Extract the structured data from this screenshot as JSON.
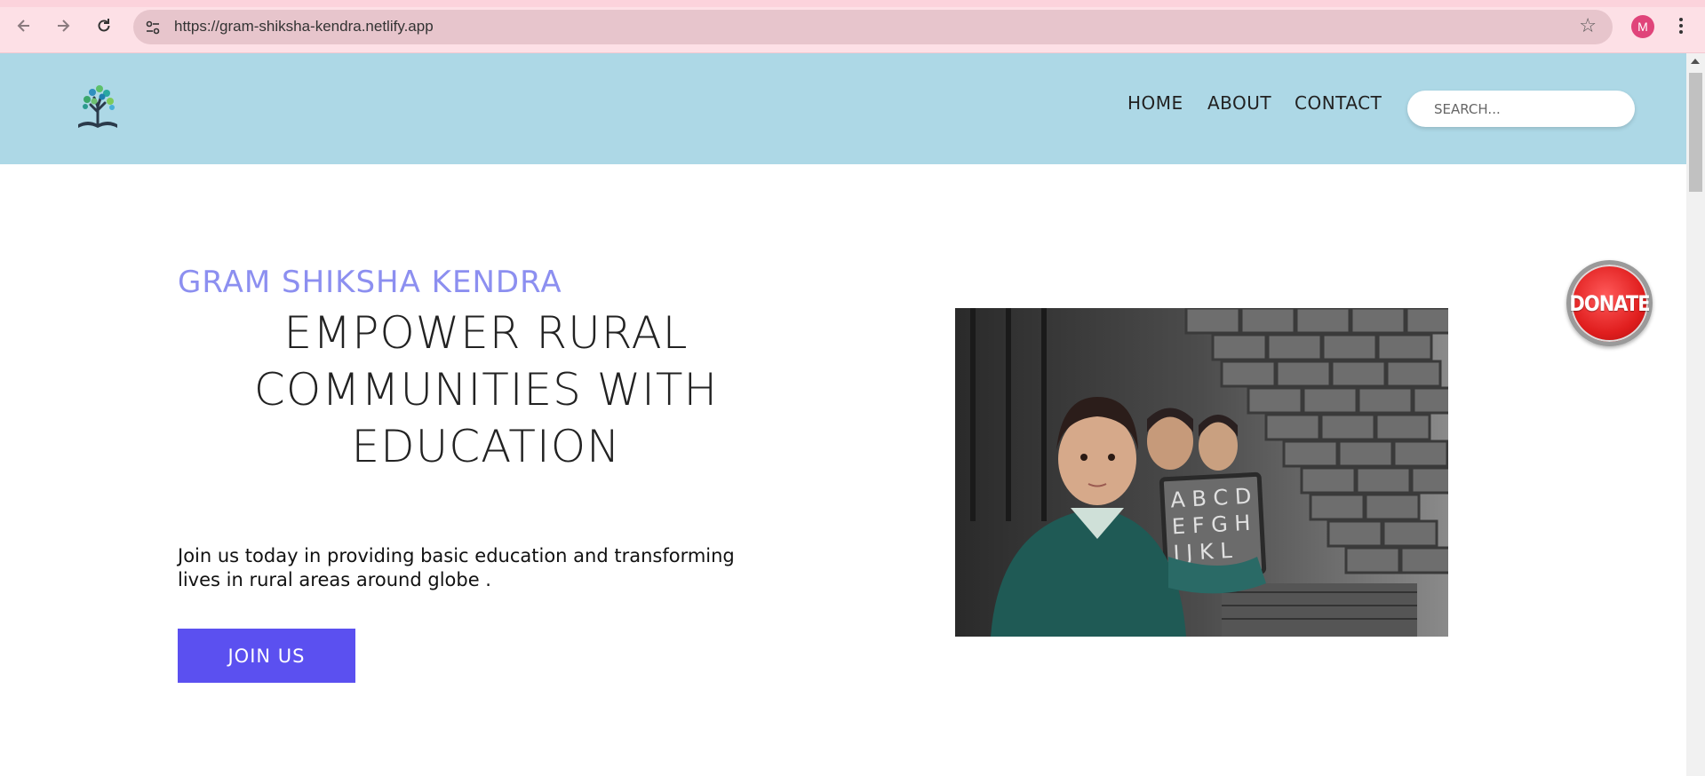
{
  "browser": {
    "url": "https://gram-shiksha-kendra.netlify.app",
    "profile_initial": "M",
    "icons": [
      "back-arrow-icon",
      "forward-arrow-icon",
      "reload-icon",
      "site-settings-icon",
      "star-icon",
      "more-menu-icon"
    ]
  },
  "header": {
    "logo_icon": "tree-book-logo",
    "nav": [
      "HOME",
      "ABOUT",
      "CONTACT"
    ],
    "search_placeholder": "SEARCH...",
    "bg_color": "#add8e6"
  },
  "hero": {
    "eyebrow": "GRAM SHIKSHA KENDRA",
    "title_lines": [
      "EMPOWER RURAL",
      "COMMUNITIES WITH",
      "EDUCATION"
    ],
    "description_lines": [
      "Join us today in providing basic education and transforming",
      "lives in rural areas around globe ."
    ],
    "cta_label": "JOIN US",
    "cta_color": "#5b50f0",
    "eyebrow_color": "#8c8ff0",
    "image": {
      "chalkboard_rows": [
        "A B C D",
        "E F G H",
        "I J K L"
      ]
    }
  },
  "donate": {
    "label": "DONATE",
    "color": "#e01e1e"
  }
}
